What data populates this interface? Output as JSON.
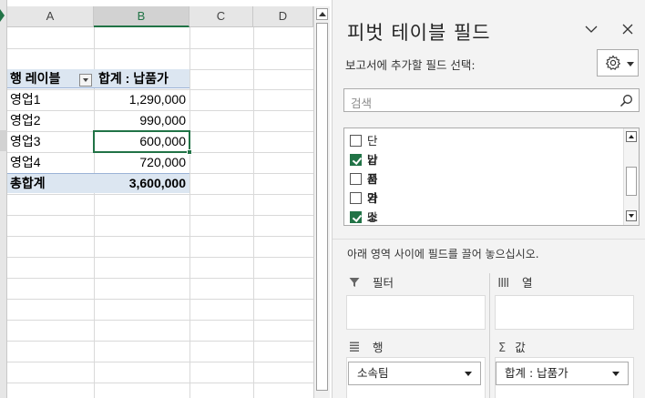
{
  "sheet": {
    "columns": [
      "A",
      "B",
      "C",
      "D"
    ],
    "selected_column": "B",
    "pivot": {
      "row_label_header": "행 레이블",
      "value_header": "합계 : 납품가",
      "rows": [
        {
          "label": "영업1",
          "value": "1,290,000"
        },
        {
          "label": "영업2",
          "value": "990,000"
        },
        {
          "label": "영업3",
          "value": "600,000"
        },
        {
          "label": "영업4",
          "value": "720,000"
        }
      ],
      "total_label": "총합계",
      "total_value": "3,600,000"
    }
  },
  "pane": {
    "title": "피벗 테이블 필드",
    "subtitle": "보고서에 추가할 필드 선택:",
    "search_placeholder": "검색",
    "fields": [
      {
        "label": "단가",
        "checked": false
      },
      {
        "label": "납품가",
        "checked": true
      },
      {
        "label": "지역",
        "checked": false
      },
      {
        "label": "담당자",
        "checked": false
      },
      {
        "label": "소속팀",
        "checked": true
      }
    ],
    "drag_hint": "아래 영역 사이에 필드를 끌어 놓으십시오.",
    "areas": {
      "filter_label": "필터",
      "columns_label": "열",
      "rows_label": "행",
      "values_label": "값",
      "rows_item": "소속팀",
      "values_item": "합계 : 납품가"
    },
    "icons": {
      "collapse": "chevron-down-icon",
      "close": "close-icon",
      "settings": "gear-icon",
      "search": "search-icon",
      "filter": "funnel-icon",
      "columns": "columns-icon",
      "rows": "rows-icon",
      "values": "sigma-icon"
    },
    "accent_color": "#217346"
  }
}
